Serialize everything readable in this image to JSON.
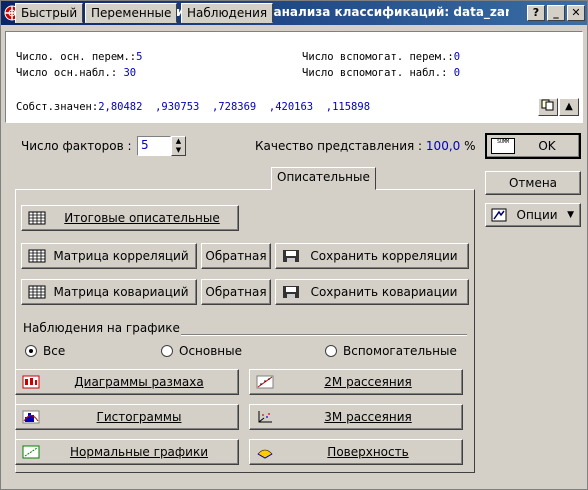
{
  "window": {
    "title": "Главные компоненты и результаты анализа классификаций: data_zan",
    "help_label": "?",
    "minimize_label": "_",
    "close_label": "✕"
  },
  "summary": {
    "vars_main_label": "Число. осн. перем.:",
    "vars_main_value": "5",
    "vars_aux_label": "Число вспомогат. перем.:",
    "vars_aux_value": "0",
    "obs_main_label": "Число осн.набл.:",
    "obs_main_value": "30",
    "obs_aux_label": "Число вспомогат. набл.:",
    "obs_aux_value": "0",
    "eigen_label": "Собст.значен:",
    "eigen_values": "2,80482  ,930753  ,728369  ,420163  ,115898"
  },
  "factors": {
    "label": "Число факторов :",
    "value": "5"
  },
  "quality": {
    "label": "Качество представления :",
    "value": "100,0",
    "unit": "%"
  },
  "side_buttons": {
    "ok_label": "OK",
    "ok_icon_text": "SUMM",
    "cancel_label": "Отмена",
    "options_label": "Опции"
  },
  "tabs": [
    {
      "label": "Быстрый"
    },
    {
      "label": "Переменные"
    },
    {
      "label": "Наблюдения"
    },
    {
      "label": "Описательные"
    }
  ],
  "actions": {
    "summary_stats": "Итоговые описательные",
    "corr_matrix": "Матрица корреляций",
    "corr_inverse": "Обратная",
    "save_corr": "Сохранить корреляции",
    "cov_matrix": "Матрица ковариаций",
    "cov_inverse": "Обратная",
    "save_cov": "Сохранить ковариации"
  },
  "plot_group": {
    "label": "Наблюдения на графике",
    "options": [
      {
        "label": "Все",
        "selected": true
      },
      {
        "label": "Основные",
        "selected": false
      },
      {
        "label": "Вспомогательные",
        "selected": false
      }
    ]
  },
  "plots": {
    "box": "Диаграммы размаха",
    "scatter2d": "2М рассеяния",
    "histograms": "Гистограммы",
    "scatter3d": "3М рассеяния",
    "normal": "Нормальные графики",
    "surface": "Поверхность"
  }
}
